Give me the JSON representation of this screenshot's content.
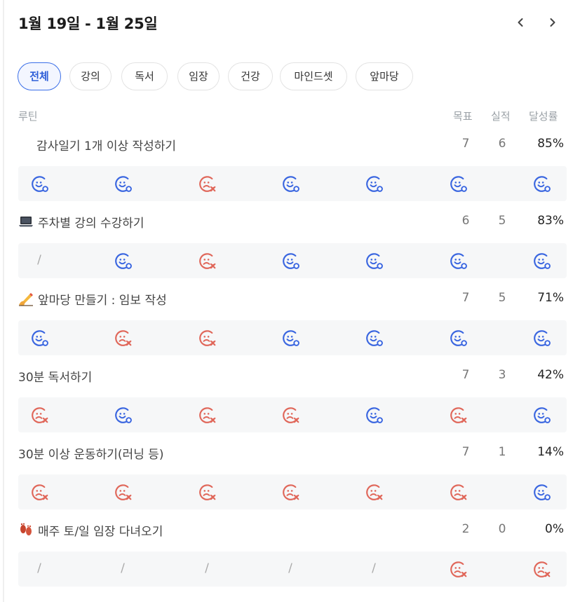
{
  "header": {
    "title": "1월 19일 - 1월 25일",
    "prev_icon": "chevron-left-icon",
    "next_icon": "chevron-right-icon"
  },
  "filters": [
    "전체",
    "강의",
    "독서",
    "임장",
    "건강",
    "마인드셋",
    "앞마당"
  ],
  "active_filter": "전체",
  "columns": {
    "routine": "루틴",
    "goal": "목표",
    "actual": "실적",
    "rate": "달성률"
  },
  "colors": {
    "success": "#3a66e0",
    "fail": "#e0675a",
    "accent": "#3b6fe8"
  },
  "routines": [
    {
      "title": "감사일기 1개 이상 작성하기",
      "icon": "none",
      "goal": "7",
      "actual": "6",
      "rate": "85%",
      "days": [
        "success",
        "success",
        "fail",
        "success",
        "success",
        "success",
        "success"
      ]
    },
    {
      "title": "주차별 강의 수강하기",
      "icon": "laptop-icon",
      "goal": "6",
      "actual": "5",
      "rate": "83%",
      "days": [
        "none",
        "success",
        "fail",
        "success",
        "success",
        "success",
        "success"
      ]
    },
    {
      "title": "앞마당 만들기 : 임보 작성",
      "icon": "writing-hand-icon",
      "goal": "7",
      "actual": "5",
      "rate": "71%",
      "days": [
        "success",
        "fail",
        "fail",
        "success",
        "success",
        "success",
        "success"
      ]
    },
    {
      "title": "30분 독서하기",
      "icon": "none",
      "goal": "7",
      "actual": "3",
      "rate": "42%",
      "days": [
        "fail",
        "success",
        "fail",
        "fail",
        "success",
        "fail",
        "success"
      ]
    },
    {
      "title": "30분 이상 운동하기(러닝 등)",
      "icon": "none",
      "goal": "7",
      "actual": "1",
      "rate": "14%",
      "days": [
        "fail",
        "fail",
        "fail",
        "fail",
        "fail",
        "fail",
        "success"
      ]
    },
    {
      "title": "매주 토/일 임장 다녀오기",
      "icon": "footprints-icon",
      "goal": "2",
      "actual": "0",
      "rate": "0%",
      "days": [
        "none",
        "none",
        "none",
        "none",
        "none",
        "fail",
        "fail"
      ]
    }
  ]
}
